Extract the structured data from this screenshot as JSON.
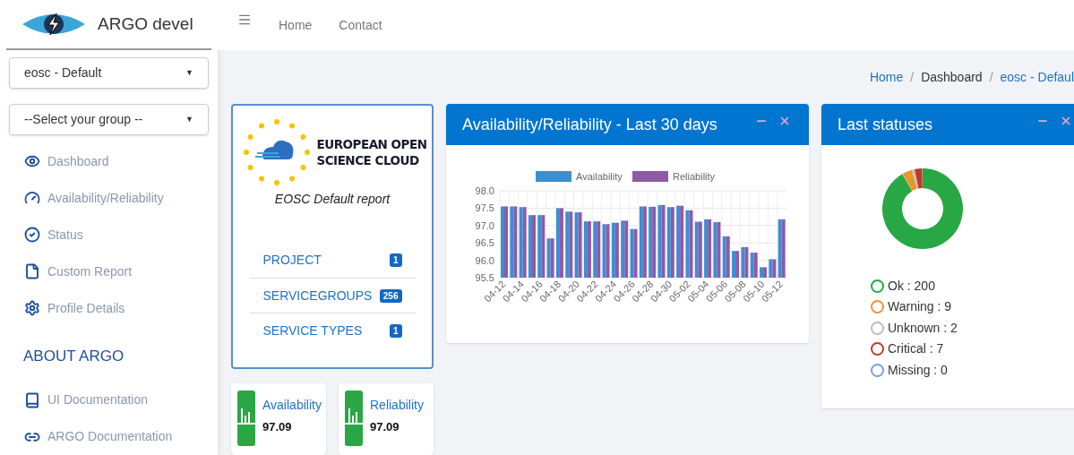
{
  "brand": {
    "title": "ARGO devel"
  },
  "sidebar": {
    "selects": [
      {
        "value": "eosc - Default",
        "arrow": "▼"
      },
      {
        "value": "--Select your group --",
        "arrow": "▼"
      }
    ],
    "items": [
      {
        "label": "Dashboard"
      },
      {
        "label": "Availability/Reliability"
      },
      {
        "label": "Status"
      },
      {
        "label": "Custom Report"
      },
      {
        "label": "Profile Details"
      }
    ],
    "section_title": "ABOUT ARGO",
    "about_items": [
      {
        "label": "UI Documentation"
      },
      {
        "label": "ARGO Documentation"
      }
    ]
  },
  "topnav": {
    "links": [
      "Home",
      "Contact"
    ]
  },
  "breadcrumb": {
    "separators": [
      "/",
      "/"
    ],
    "items": [
      {
        "label": "Home",
        "link": true
      },
      {
        "label": "Dashboard",
        "link": false
      },
      {
        "label": "eosc - Defaul",
        "link": true
      }
    ]
  },
  "report_card": {
    "logo_text": [
      "EUROPEAN OPEN",
      "SCIENCE CLOUD"
    ],
    "caption": "EOSC Default report",
    "items": [
      {
        "label": "PROJECT",
        "count": "1"
      },
      {
        "label": "SERVICEGROUPS",
        "count": "256"
      },
      {
        "label": "SERVICE TYPES",
        "count": "1"
      }
    ]
  },
  "tiles": [
    {
      "label": "Availability",
      "value": "97.09"
    },
    {
      "label": "Reliability",
      "value": "97.09"
    }
  ],
  "ar_card": {
    "title": "Availability/Reliability - Last 30 days",
    "chart_data": {
      "type": "bar",
      "grid": true,
      "legend": true,
      "stacked": false,
      "categories": [
        "04-12",
        null,
        "04-14",
        null,
        "04-16",
        null,
        "04-18",
        null,
        "04-20",
        null,
        "04-22",
        null,
        "04-24",
        null,
        "04-26",
        null,
        "04-28",
        null,
        "04-30",
        null,
        "05-02",
        null,
        "05-04",
        null,
        "05-06",
        null,
        "05-08",
        null,
        "05-10",
        null,
        "05-12"
      ],
      "series": [
        {
          "name": "Availability",
          "color": "#3c8fd0",
          "values": [
            97.55,
            97.55,
            97.53,
            97.3,
            97.3,
            96.63,
            97.5,
            97.4,
            97.38,
            97.12,
            97.12,
            97.04,
            97.08,
            97.14,
            96.9,
            97.55,
            97.54,
            97.59,
            97.53,
            97.57,
            97.44,
            97.11,
            97.18,
            97.1,
            96.69,
            96.27,
            96.38,
            96.22,
            95.8,
            96.03,
            97.18
          ]
        },
        {
          "name": "Reliability",
          "color": "#8e5aa8",
          "values": [
            97.55,
            97.55,
            97.53,
            97.3,
            97.3,
            96.63,
            97.5,
            97.4,
            97.38,
            97.12,
            97.12,
            97.04,
            97.08,
            97.14,
            96.9,
            97.55,
            97.54,
            97.59,
            97.53,
            97.57,
            97.44,
            97.11,
            97.18,
            97.1,
            96.69,
            96.27,
            96.38,
            96.22,
            95.8,
            96.03,
            97.18
          ]
        }
      ],
      "ylim": [
        95.5,
        98.0
      ],
      "yticks": [
        95.5,
        {
          "value": 96,
          "label": "96.0"
        },
        96.5,
        {
          "value": 97,
          "label": "97.0"
        },
        97.5,
        {
          "value": 98,
          "label": "98.0"
        }
      ]
    }
  },
  "status_card": {
    "title": "Last statuses",
    "legend": [
      {
        "label": "Ok : 200",
        "color": "#28a745"
      },
      {
        "label": "Warning : 9",
        "color": "#e8962e"
      },
      {
        "label": "Unknown : 2",
        "color": "#bbbbbb"
      },
      {
        "label": "Critical : 7",
        "color": "#c0392b"
      },
      {
        "label": "Missing : 0",
        "color": "#7aa0d8"
      }
    ],
    "chart_data": {
      "type": "donut",
      "values": [
        91.74,
        4.13,
        0.92,
        3.21,
        0
      ]
    }
  }
}
